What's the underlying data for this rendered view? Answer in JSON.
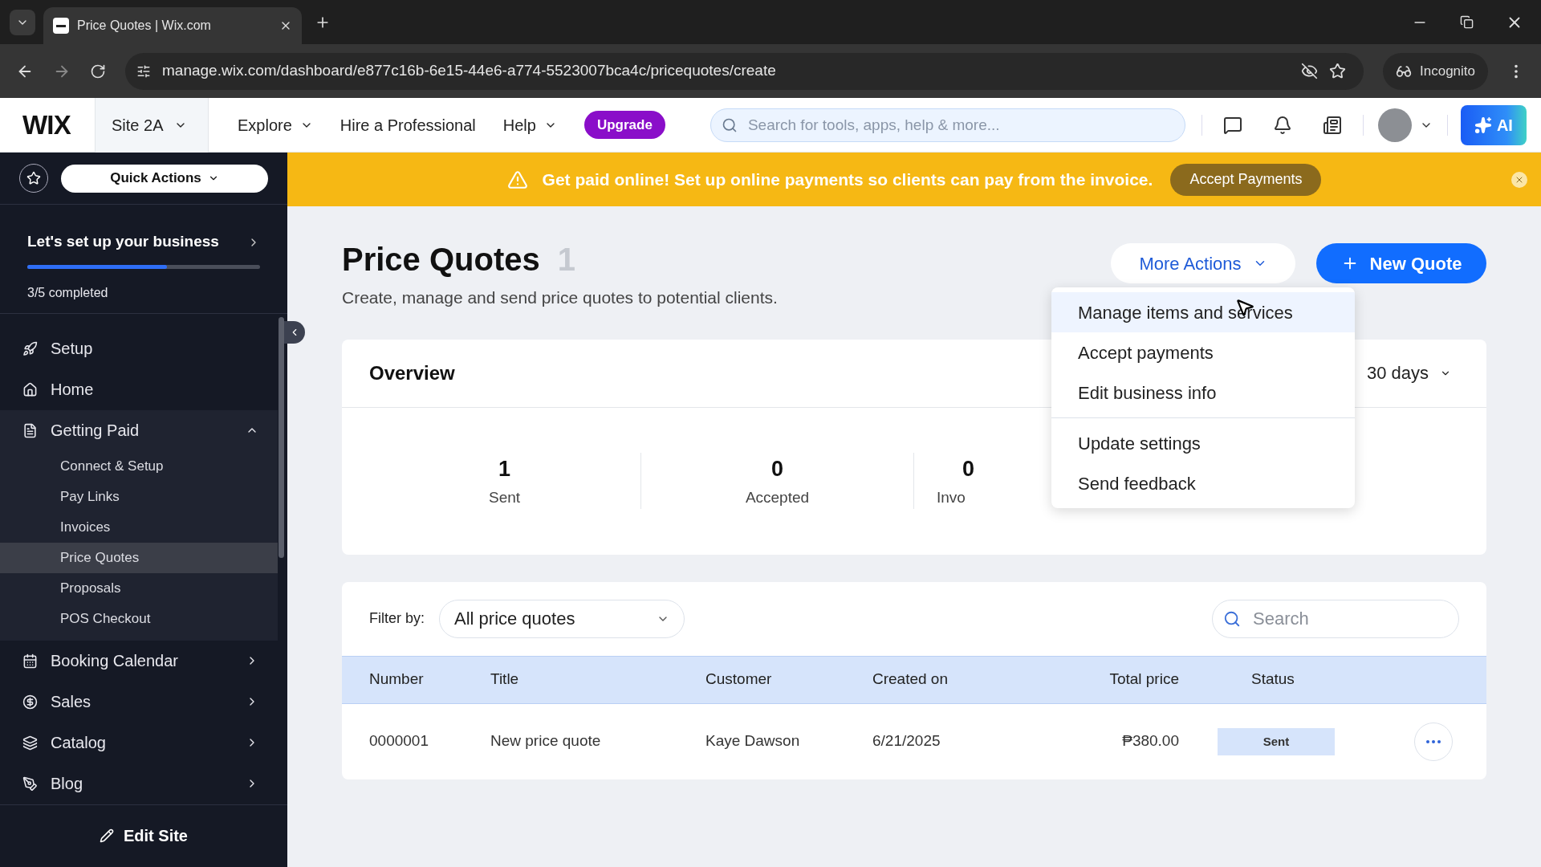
{
  "browser": {
    "tab_title": "Price Quotes | Wix.com",
    "url": "manage.wix.com/dashboard/e877c16b-6e15-44e6-a774-5523007bca4c/pricequotes/create",
    "profile": "Incognito"
  },
  "header": {
    "logo": "WIX",
    "site": "Site 2A",
    "nav": [
      {
        "label": "Explore",
        "dropdown": true
      },
      {
        "label": "Hire a Professional",
        "dropdown": false
      },
      {
        "label": "Help",
        "dropdown": true
      }
    ],
    "upgrade": "Upgrade",
    "search": {
      "placeholder": "Search for tools, apps, help & more..."
    },
    "ai": "AI"
  },
  "sidebar": {
    "quick_actions": "Quick Actions",
    "setup": {
      "title": "Let's set up your business",
      "level": 0.6,
      "progress": "3/5 completed"
    },
    "items": [
      {
        "label": "Setup",
        "kind": "link"
      },
      {
        "label": "Home",
        "kind": "link"
      },
      {
        "label": "Getting Paid",
        "kind": "group",
        "expanded": true,
        "children": [
          {
            "label": "Connect & Setup",
            "selected": false
          },
          {
            "label": "Pay Links",
            "selected": false
          },
          {
            "label": "Invoices",
            "selected": false
          },
          {
            "label": "Price Quotes",
            "selected": true
          },
          {
            "label": "Proposals",
            "selected": false
          },
          {
            "label": "POS Checkout",
            "selected": false
          }
        ]
      },
      {
        "label": "Booking Calendar",
        "kind": "group",
        "expanded": false
      },
      {
        "label": "Sales",
        "kind": "group",
        "expanded": false
      },
      {
        "label": "Catalog",
        "kind": "group",
        "expanded": false
      },
      {
        "label": "Blog",
        "kind": "group",
        "expanded": false
      }
    ],
    "edit_site": "Edit Site"
  },
  "banner": {
    "message": "Get paid online! Set up online payments so clients can pay from the invoice.",
    "button": "Accept Payments"
  },
  "page": {
    "title": "Price Quotes",
    "count": "1",
    "subtitle": "Create, manage and send price quotes to potential clients.",
    "more_actions": "More Actions",
    "new_quote": "New Quote"
  },
  "menu": {
    "groups": [
      [
        {
          "label": "Manage items and services",
          "selected": true
        },
        {
          "label": "Accept payments",
          "selected": false
        },
        {
          "label": "Edit business info",
          "selected": false
        }
      ],
      [
        {
          "label": "Update settings",
          "selected": false
        },
        {
          "label": "Send feedback",
          "selected": false
        }
      ]
    ]
  },
  "overview": {
    "title": "Overview",
    "range": "30 days",
    "stats": [
      {
        "value": "1",
        "label": "Sent"
      },
      {
        "value": "0",
        "label": "Accepted"
      },
      {
        "value": "0",
        "label": "Invo"
      }
    ]
  },
  "table": {
    "filter_label": "Filter by:",
    "filter_value": "All price quotes",
    "search": {
      "placeholder": "Search"
    },
    "columns": [
      "Number",
      "Title",
      "Customer",
      "Created on",
      "Total price",
      "Status"
    ],
    "rows": [
      {
        "number": "0000001",
        "title": "New price quote",
        "customer": "Kaye Dawson",
        "created": "6/21/2025",
        "total": "₱380.00",
        "status": "Sent"
      }
    ]
  }
}
